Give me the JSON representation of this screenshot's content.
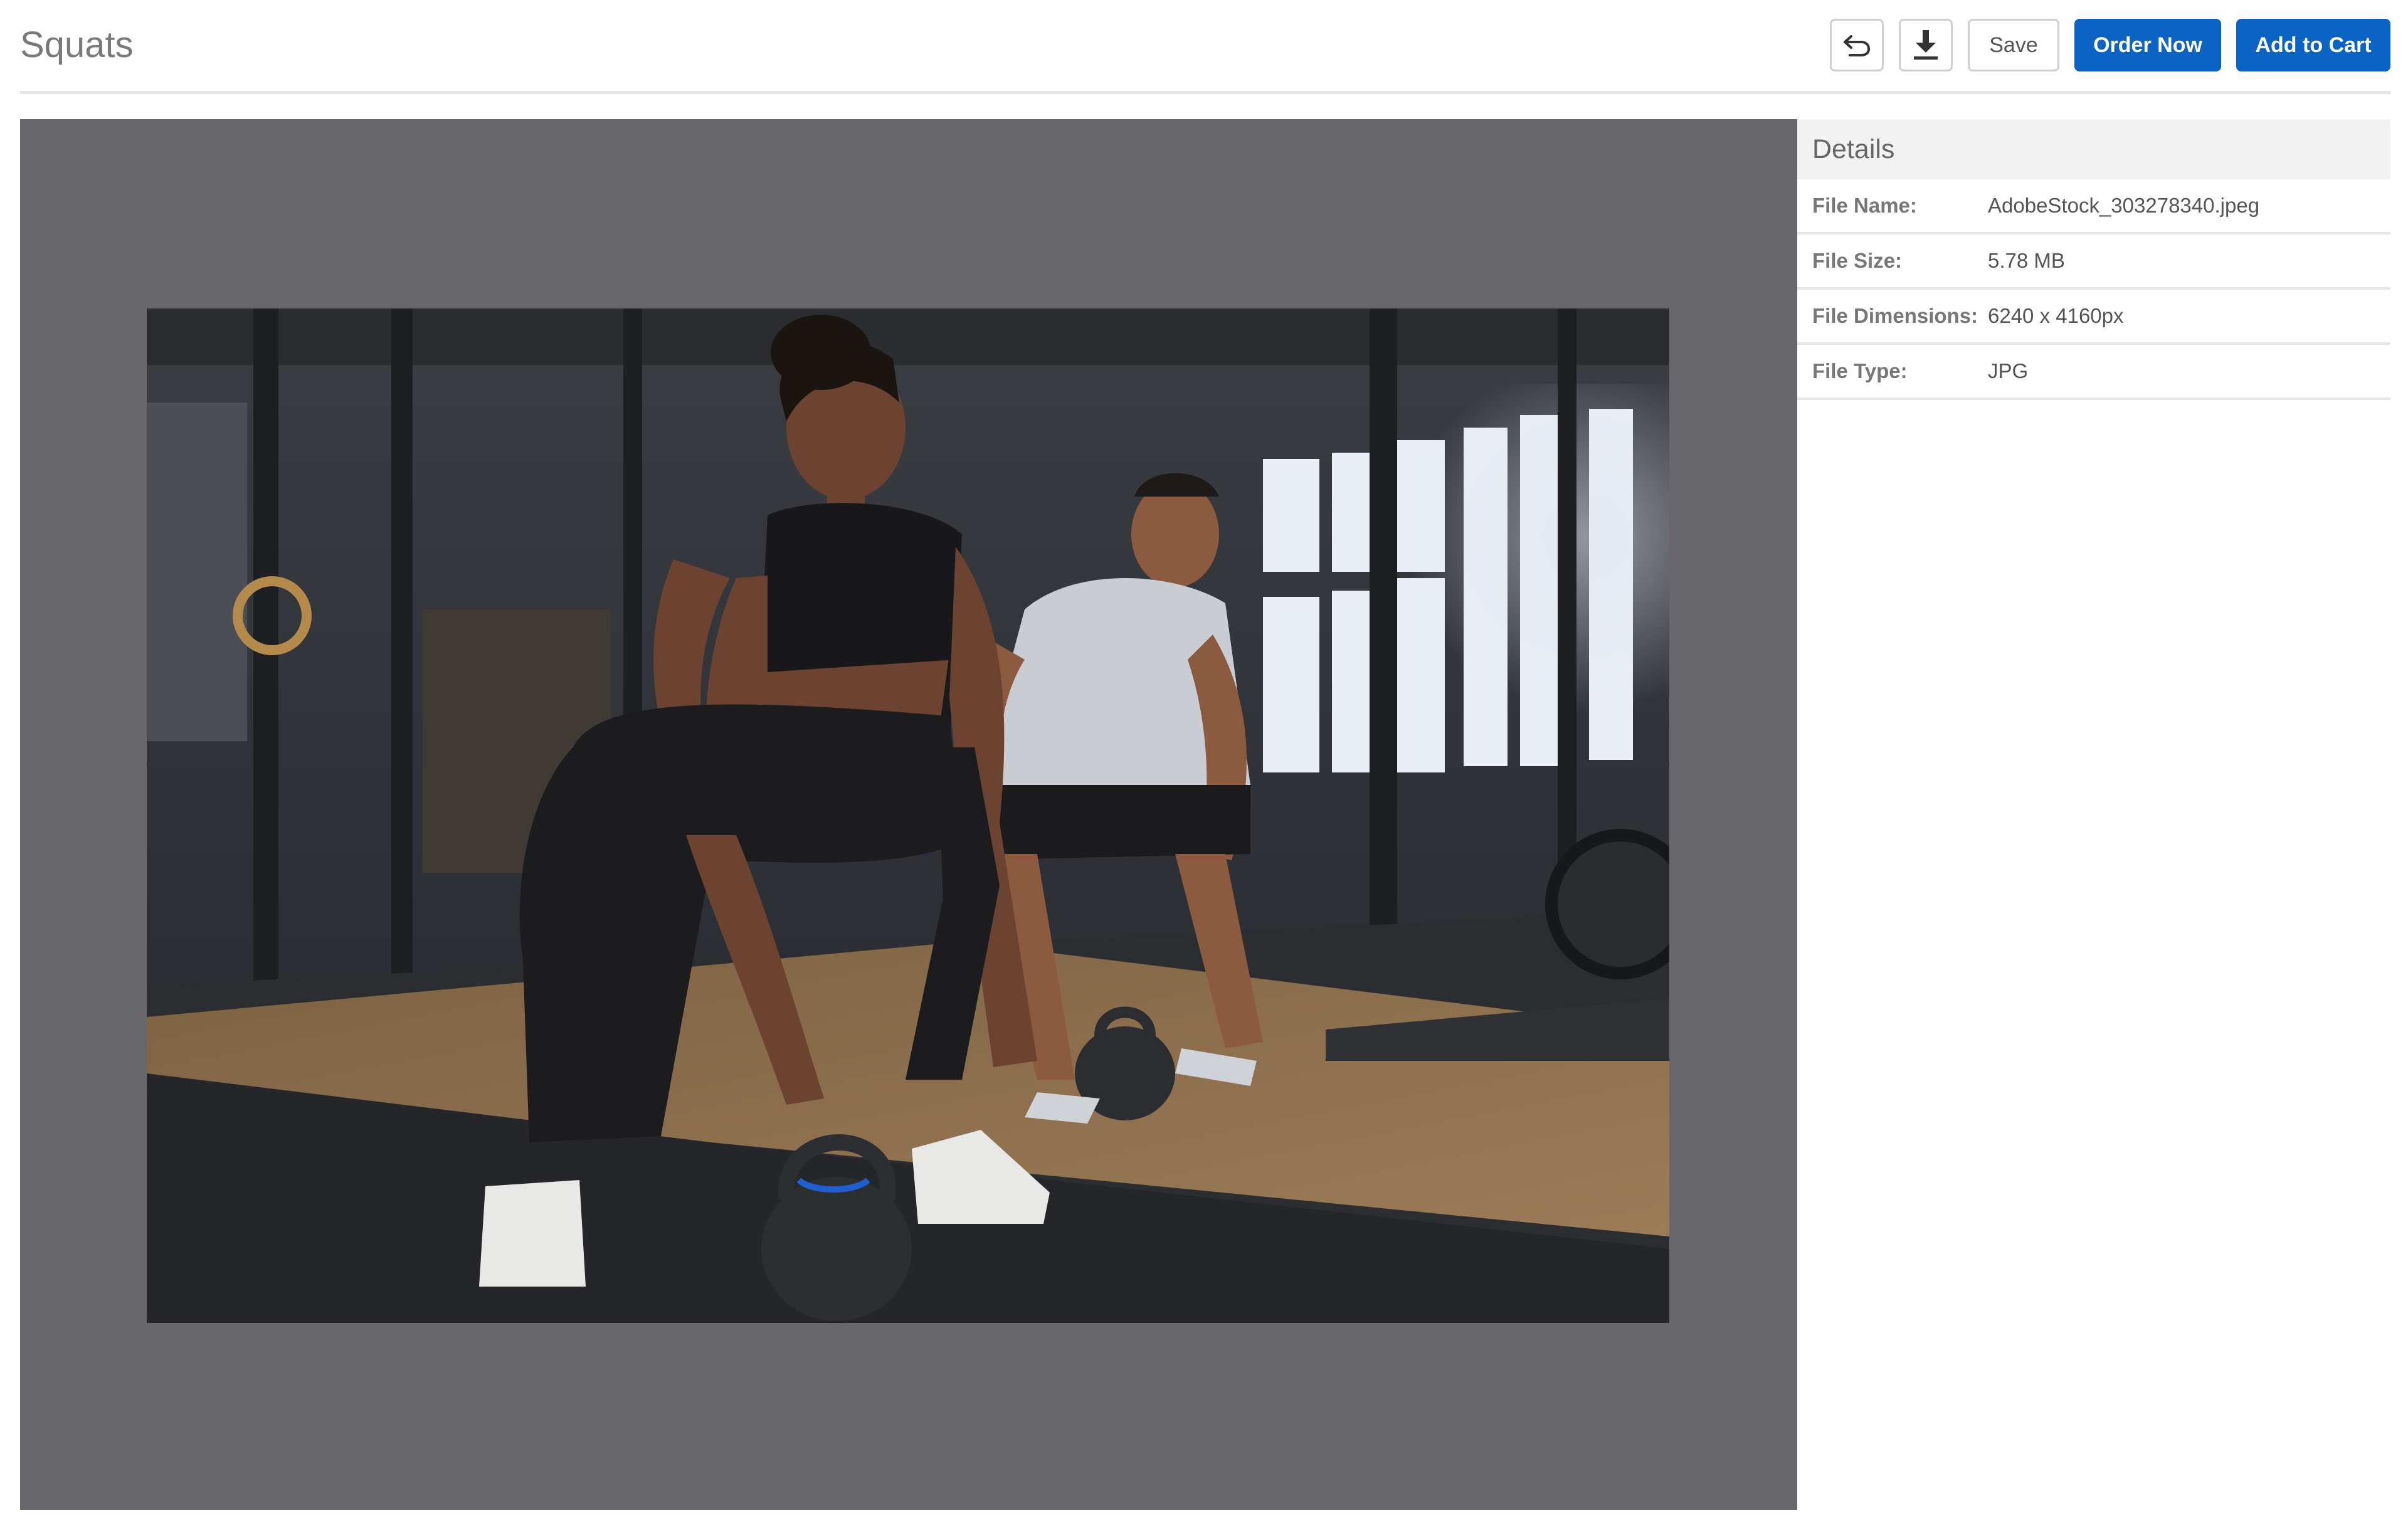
{
  "header": {
    "title": "Squats"
  },
  "toolbar": {
    "undo_icon": "undo-icon",
    "download_icon": "download-icon",
    "save_label": "Save",
    "order_now_label": "Order Now",
    "add_to_cart_label": "Add to Cart"
  },
  "colors": {
    "primary": "#0b63c4",
    "preview_background": "#67666a"
  },
  "preview": {
    "image_description_icon": "stock-photo"
  },
  "details": {
    "title": "Details",
    "rows": [
      {
        "label": "File Name:",
        "value": "AdobeStock_303278340.jpeg"
      },
      {
        "label": "File Size:",
        "value": "5.78 MB"
      },
      {
        "label": "File Dimensions:",
        "value": "6240 x 4160px"
      },
      {
        "label": "File Type:",
        "value": "JPG"
      }
    ]
  }
}
